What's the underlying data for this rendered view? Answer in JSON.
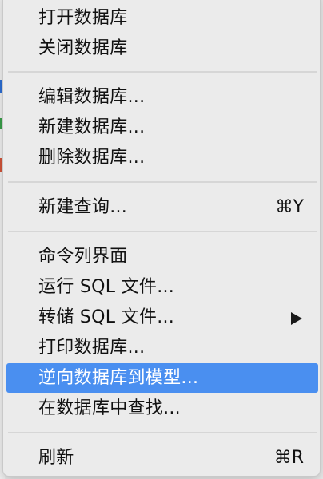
{
  "colors": {
    "menu_bg": "#ebebeb",
    "highlight": "#4a8ff0",
    "text": "#111111",
    "highlight_text": "#ffffff",
    "separator": "#d6d6d6"
  },
  "menu": {
    "items": [
      {
        "label": "打开数据库"
      },
      {
        "label": "关闭数据库"
      },
      {
        "label": "编辑数据库..."
      },
      {
        "label": "新建数据库..."
      },
      {
        "label": "删除数据库..."
      },
      {
        "label": "新建查询...",
        "shortcut": "⌘Y"
      },
      {
        "label": "命令列界面"
      },
      {
        "label": "运行 SQL 文件..."
      },
      {
        "label": "转储 SQL 文件...",
        "submenu_icon": "triangle-right-icon"
      },
      {
        "label": "打印数据库..."
      },
      {
        "label": "逆向数据库到模型...",
        "highlighted": true
      },
      {
        "label": "在数据库中查找..."
      },
      {
        "label": "刷新",
        "shortcut": "⌘R"
      }
    ]
  }
}
